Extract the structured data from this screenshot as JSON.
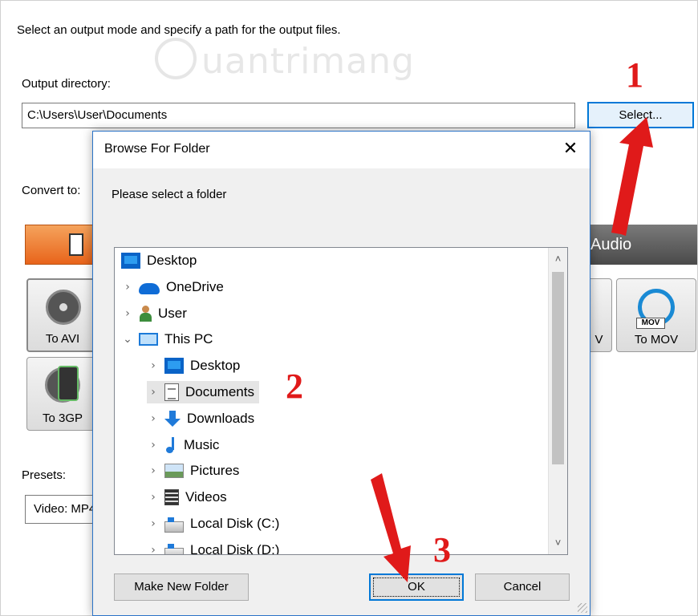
{
  "main": {
    "intro": "Select an output mode and specify a path for the output files.",
    "output_directory_label": "Output directory:",
    "output_directory_value": "C:\\Users\\User\\Documents",
    "select_button": "Select...",
    "convert_to_label": "Convert to:",
    "audio_tab": "Audio",
    "formats": {
      "avi": "To AVI",
      "gp3": "To 3GP",
      "wmv": "V",
      "mov": "To MOV",
      "mov_badge": "MOV"
    },
    "presets_label": "Presets:",
    "preset_value": "Video: MP4"
  },
  "watermark": "uantrimang",
  "dialog": {
    "title": "Browse For Folder",
    "close_glyph": "✕",
    "prompt": "Please select a folder",
    "tree": [
      {
        "label": "Desktop",
        "icon": "desktop-icon",
        "chevron": "",
        "level": 0
      },
      {
        "label": "OneDrive",
        "icon": "onedrive-icon",
        "chevron": "›",
        "level": 1
      },
      {
        "label": "User",
        "icon": "user-icon",
        "chevron": "›",
        "level": 1
      },
      {
        "label": "This PC",
        "icon": "this-pc-icon",
        "chevron": "⌄",
        "level": 1
      },
      {
        "label": "Desktop",
        "icon": "desktop-icon",
        "chevron": "›",
        "level": 2
      },
      {
        "label": "Documents",
        "icon": "documents-icon",
        "chevron": "›",
        "level": 2,
        "selected": true
      },
      {
        "label": "Downloads",
        "icon": "downloads-icon",
        "chevron": "›",
        "level": 2
      },
      {
        "label": "Music",
        "icon": "music-icon",
        "chevron": "›",
        "level": 2
      },
      {
        "label": "Pictures",
        "icon": "pictures-icon",
        "chevron": "›",
        "level": 2
      },
      {
        "label": "Videos",
        "icon": "videos-icon",
        "chevron": "›",
        "level": 2
      },
      {
        "label": "Local Disk (C:)",
        "icon": "local-disk-icon",
        "chevron": "›",
        "level": 2
      },
      {
        "label": "Local Disk (D:)",
        "icon": "local-disk-icon",
        "chevron": "›",
        "level": 2
      }
    ],
    "scroll_up": "˄",
    "scroll_down": "˅",
    "make_new_folder": "Make New Folder",
    "ok": "OK",
    "cancel": "Cancel"
  },
  "annotations": {
    "step1": "1",
    "step2": "2",
    "step3": "3",
    "color": "#e01a1a"
  }
}
